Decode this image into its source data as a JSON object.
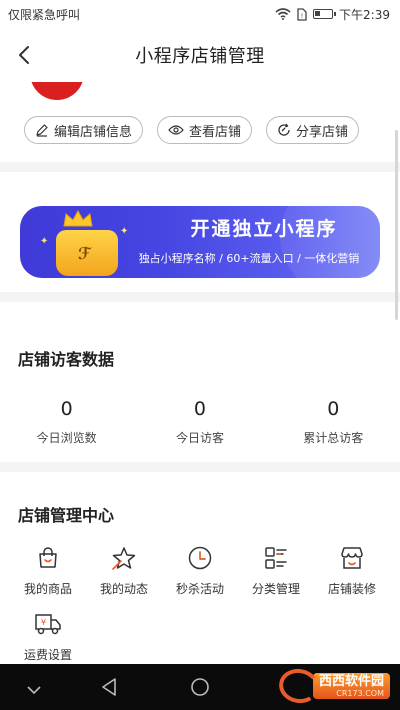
{
  "status_bar": {
    "carrier": "仅限紧急呼叫",
    "time": "下午2:39",
    "battery_level": 0.35
  },
  "nav": {
    "title": "小程序店铺管理"
  },
  "store_actions": [
    {
      "label": "编辑店铺信息",
      "icon": "edit-icon"
    },
    {
      "label": "查看店铺",
      "icon": "eye-icon"
    },
    {
      "label": "分享店铺",
      "icon": "share-icon"
    }
  ],
  "banner": {
    "title": "开通独立小程序",
    "subtitle": "独占小程序名称 / 60+流量入口 / 一体化营销",
    "colors": {
      "start": "#3f3ad8",
      "end": "#7b83f6",
      "bag": "#f3a41c"
    }
  },
  "visitor_stats": {
    "title": "店铺访客数据",
    "items": [
      {
        "value": "0",
        "label": "今日浏览数"
      },
      {
        "value": "0",
        "label": "今日访客"
      },
      {
        "value": "0",
        "label": "累计总访客"
      }
    ]
  },
  "management": {
    "title": "店铺管理中心",
    "items": [
      {
        "label": "我的商品",
        "icon": "shopping-bag-icon"
      },
      {
        "label": "我的动态",
        "icon": "star-icon"
      },
      {
        "label": "秒杀活动",
        "icon": "clock-icon"
      },
      {
        "label": "分类管理",
        "icon": "category-list-icon"
      },
      {
        "label": "店铺装修",
        "icon": "storefront-icon"
      },
      {
        "label": "运费设置",
        "icon": "delivery-truck-icon"
      }
    ]
  },
  "watermark": {
    "brand": "西西软件园",
    "domain": "CR173.COM"
  },
  "accent_color": "#e85c2a"
}
